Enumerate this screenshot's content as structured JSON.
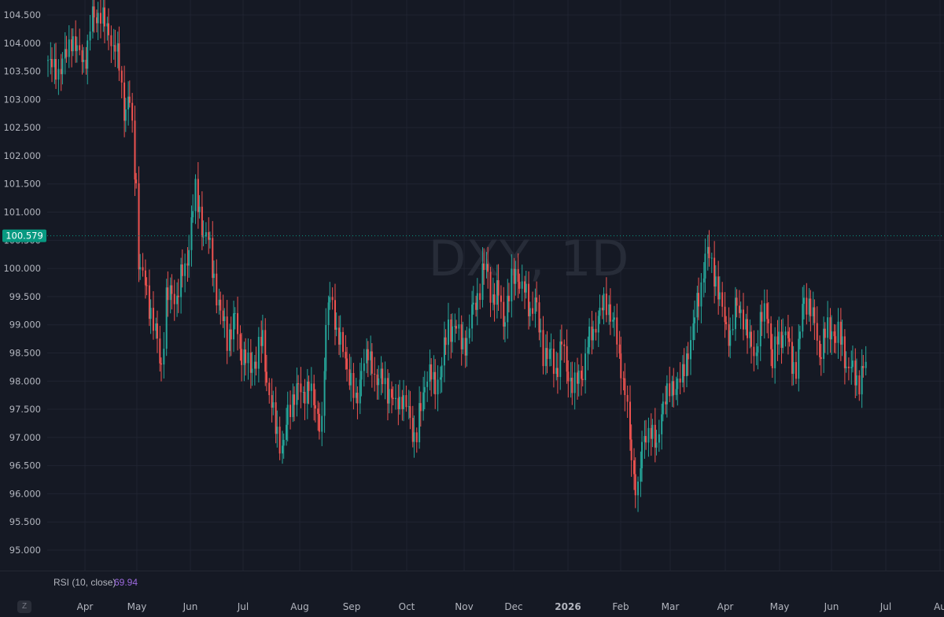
{
  "chart_data": {
    "type": "candlestick",
    "symbol": "DXY",
    "timeframe": "1D",
    "watermark": "DXY, 1D",
    "last_price": "100.579",
    "last_value": 100.579,
    "ylim": [
      94.8,
      104.8
    ],
    "y_ticks": [
      "104.500",
      "104.000",
      "103.500",
      "103.000",
      "102.500",
      "102.000",
      "101.500",
      "101.000",
      "100.500",
      "100.000",
      "99.500",
      "99.000",
      "98.500",
      "98.000",
      "97.500",
      "97.000",
      "96.500",
      "96.000",
      "95.500",
      "95.000"
    ],
    "x_ticks": [
      "Apr",
      "May",
      "Jun",
      "Jul",
      "Aug",
      "Sep",
      "Oct",
      "Nov",
      "Dec",
      "2026",
      "Feb",
      "Mar",
      "Apr",
      "May",
      "Jun",
      "Jul",
      "Au"
    ],
    "year_tick": "2026",
    "path": [
      [
        0,
        103.7
      ],
      [
        8,
        103.5
      ],
      [
        18,
        104.1
      ],
      [
        28,
        103.6
      ],
      [
        33,
        104.4
      ],
      [
        40,
        104.5
      ],
      [
        45,
        104.2
      ],
      [
        52,
        103.9
      ],
      [
        58,
        102.9
      ],
      [
        62,
        103.0
      ],
      [
        67,
        101.5
      ],
      [
        69,
        100.2
      ],
      [
        73,
        99.7
      ],
      [
        78,
        99.3
      ],
      [
        83,
        98.6
      ],
      [
        86,
        98.2
      ],
      [
        90,
        99.5
      ],
      [
        95,
        99.4
      ],
      [
        100,
        99.8
      ],
      [
        104,
        99.9
      ],
      [
        107,
        100.5
      ],
      [
        111,
        101.4
      ],
      [
        115,
        101.0
      ],
      [
        121,
        100.5
      ],
      [
        126,
        99.9
      ],
      [
        131,
        99.1
      ],
      [
        136,
        98.8
      ],
      [
        142,
        99.0
      ],
      [
        148,
        98.5
      ],
      [
        153,
        98.2
      ],
      [
        158,
        98.5
      ],
      [
        163,
        98.7
      ],
      [
        168,
        97.8
      ],
      [
        172,
        97.2
      ],
      [
        178,
        96.8
      ],
      [
        183,
        97.4
      ],
      [
        188,
        97.9
      ],
      [
        193,
        97.7
      ],
      [
        198,
        98.0
      ],
      [
        203,
        97.5
      ],
      [
        208,
        97.3
      ],
      [
        212,
        99.3
      ],
      [
        215,
        99.7
      ],
      [
        219,
        98.8
      ],
      [
        224,
        98.6
      ],
      [
        229,
        98.0
      ],
      [
        234,
        97.6
      ],
      [
        239,
        98.3
      ],
      [
        244,
        98.5
      ],
      [
        249,
        98.0
      ],
      [
        254,
        98.1
      ],
      [
        259,
        97.8
      ],
      [
        264,
        97.6
      ],
      [
        269,
        97.7
      ],
      [
        274,
        97.4
      ],
      [
        279,
        96.9
      ],
      [
        284,
        97.6
      ],
      [
        289,
        98.3
      ],
      [
        294,
        97.8
      ],
      [
        299,
        98.4
      ],
      [
        304,
        98.9
      ],
      [
        309,
        99.1
      ],
      [
        314,
        98.6
      ],
      [
        318,
        98.8
      ],
      [
        323,
        99.2
      ],
      [
        328,
        99.7
      ],
      [
        332,
        100.0
      ],
      [
        336,
        99.6
      ],
      [
        341,
        99.5
      ],
      [
        346,
        99.2
      ],
      [
        351,
        99.6
      ],
      [
        356,
        100.1
      ],
      [
        360,
        99.6
      ],
      [
        365,
        99.4
      ],
      [
        370,
        99.3
      ],
      [
        375,
        98.6
      ],
      [
        380,
        98.4
      ],
      [
        385,
        98.2
      ],
      [
        390,
        98.6
      ],
      [
        395,
        98.2
      ],
      [
        400,
        97.9
      ],
      [
        405,
        98.2
      ],
      [
        410,
        98.6
      ],
      [
        415,
        99.0
      ],
      [
        420,
        99.2
      ],
      [
        425,
        99.4
      ],
      [
        430,
        98.9
      ],
      [
        435,
        98.3
      ],
      [
        440,
        97.5
      ],
      [
        444,
        96.4
      ],
      [
        448,
        96.1
      ],
      [
        452,
        97.0
      ],
      [
        457,
        97.2
      ],
      [
        462,
        96.8
      ],
      [
        467,
        97.6
      ],
      [
        472,
        97.8
      ],
      [
        477,
        97.9
      ],
      [
        482,
        98.1
      ],
      [
        487,
        98.6
      ],
      [
        492,
        99.3
      ],
      [
        496,
        99.7
      ],
      [
        500,
        100.4
      ],
      [
        505,
        100.0
      ],
      [
        510,
        99.5
      ],
      [
        514,
        99.0
      ],
      [
        518,
        98.8
      ],
      [
        523,
        99.3
      ],
      [
        527,
        99.2
      ],
      [
        532,
        98.7
      ],
      [
        537,
        98.5
      ],
      [
        542,
        99.1
      ],
      [
        546,
        99.4
      ],
      [
        550,
        98.3
      ],
      [
        554,
        98.8
      ],
      [
        559,
        98.9
      ],
      [
        564,
        98.4
      ],
      [
        569,
        98.2
      ],
      [
        573,
        99.3
      ],
      [
        577,
        99.5
      ],
      [
        582,
        98.9
      ],
      [
        586,
        98.6
      ],
      [
        590,
        98.8
      ],
      [
        595,
        99.0
      ],
      [
        600,
        98.8
      ],
      [
        605,
        98.5
      ],
      [
        610,
        98.1
      ],
      [
        615,
        98.0
      ],
      [
        620,
        98.2
      ]
    ],
    "rsi": {
      "label": "RSI (10, close)",
      "value": "69.94"
    }
  },
  "colors": {
    "background": "#151924",
    "grid": "#202431",
    "up": "#26a69a",
    "down": "#ef5350",
    "axis_text": "#b2b5be",
    "price_tag": "#089981",
    "rsi_value": "#9c6ade"
  }
}
